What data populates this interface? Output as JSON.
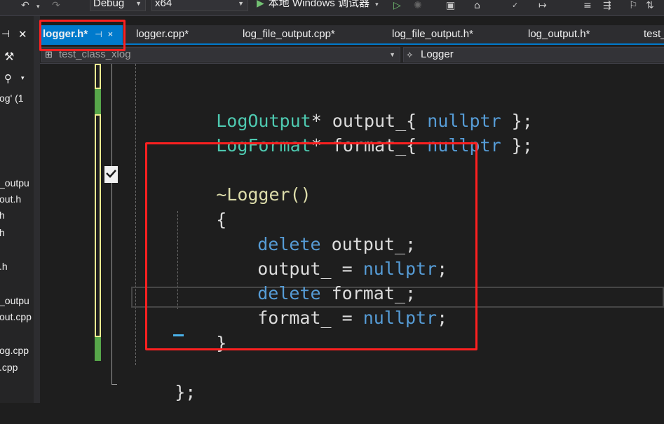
{
  "toolbar": {
    "undo_icon": "undo-icon",
    "redo_icon": "redo-icon",
    "configuration": "Debug",
    "platform": "x64",
    "run_label": "本地 Windows 调试器",
    "icons": [
      "play-outline-icon",
      "attach-icon",
      "find-icon",
      "layout-icon",
      "spellcheck-icon",
      "step-icon",
      "comment-icon",
      "bookmark-icon"
    ]
  },
  "left_panel": {
    "items": [
      "og' (1",
      "_outpu",
      "out.h",
      "h",
      "h",
      ".h",
      "_outpu",
      "out.cpp",
      "og.cpp",
      ".cpp"
    ]
  },
  "tabs": [
    {
      "label": "logger.h*",
      "active": true
    },
    {
      "label": "logger.cpp*",
      "active": false
    },
    {
      "label": "log_file_output.cpp*",
      "active": false
    },
    {
      "label": "log_file_output.h*",
      "active": false
    },
    {
      "label": "log_output.h*",
      "active": false
    },
    {
      "label": "test_",
      "active": false
    }
  ],
  "tab_pin_glyph": "⊣",
  "tab_close_glyph": "×",
  "navbar": {
    "project": "test_class_xlog",
    "member": "Logger"
  },
  "code": {
    "line1": {
      "type": "LogOutput",
      "rest": "* output_{ ",
      "kw": "nullptr",
      "end": " };"
    },
    "line2": {
      "type": "LogFormat",
      "rest": "* format_{ ",
      "kw": "nullptr",
      "end": " };"
    },
    "dtor": "~Logger()",
    "open_brace": "{",
    "body1": {
      "kw": "delete",
      "rest": " output_;"
    },
    "body2": {
      "rest": "output_ = ",
      "kw": "nullptr",
      "end": ";"
    },
    "body3": {
      "kw": "delete",
      "rest": " format_;"
    },
    "body4": {
      "rest": "format_ = ",
      "kw": "nullptr",
      "end": ";"
    },
    "close_brace": "}",
    "class_end": "};"
  },
  "colors": {
    "accent": "#007acc",
    "type": "#4ec9b0",
    "keyword": "#569cd6",
    "highlight_box": "#ff2020"
  }
}
